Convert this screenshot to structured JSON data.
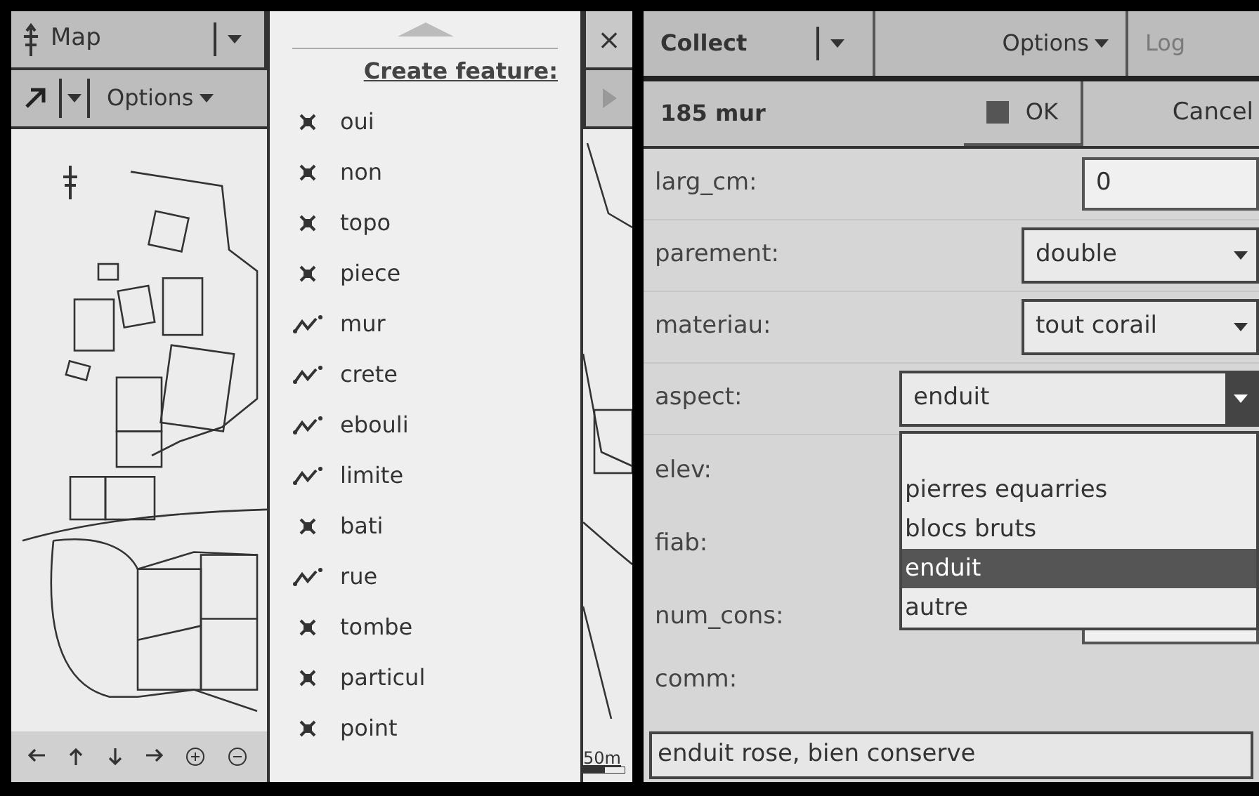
{
  "left_screen": {
    "toolbar": {
      "map_menu": "Map",
      "options_menu": "Options",
      "close_button": "×"
    },
    "create_menu": {
      "title": "Create feature:",
      "items": [
        {
          "label": "oui",
          "kind": "point"
        },
        {
          "label": "non",
          "kind": "point"
        },
        {
          "label": "topo",
          "kind": "point"
        },
        {
          "label": "piece",
          "kind": "point"
        },
        {
          "label": "mur",
          "kind": "line"
        },
        {
          "label": "crete",
          "kind": "line"
        },
        {
          "label": "ebouli",
          "kind": "line"
        },
        {
          "label": "limite",
          "kind": "line"
        },
        {
          "label": "bati",
          "kind": "point"
        },
        {
          "label": "rue",
          "kind": "line"
        },
        {
          "label": "tombe",
          "kind": "point"
        },
        {
          "label": "particul",
          "kind": "point"
        },
        {
          "label": "point",
          "kind": "point"
        }
      ]
    },
    "scale_label": "50m"
  },
  "right_screen": {
    "toolbar": {
      "collect_menu": "Collect",
      "options_menu": "Options",
      "log_tab": {
        "label": "Log",
        "disabled": true
      }
    },
    "feature": {
      "title": "185 mur",
      "ok": "OK",
      "cancel": "Cancel"
    },
    "fields": [
      {
        "label": "larg_cm:",
        "kind": "text",
        "value": "0"
      },
      {
        "label": "parement:",
        "kind": "select",
        "value": "double",
        "expanded": false
      },
      {
        "label": "materiau:",
        "kind": "select",
        "value": "tout corail",
        "expanded": false
      },
      {
        "label": "aspect:",
        "kind": "select",
        "value": "enduit",
        "expanded": true
      },
      {
        "label": "elev:",
        "kind": "none"
      },
      {
        "label": "fiab:",
        "kind": "none"
      },
      {
        "label": "num_cons:",
        "kind": "text"
      }
    ],
    "dropdown": {
      "options": [
        {
          "label": "pierres equarries",
          "selected": false
        },
        {
          "label": "blocs bruts",
          "selected": false
        },
        {
          "label": "enduit",
          "selected": true
        },
        {
          "label": "autre",
          "selected": false
        }
      ]
    },
    "comment": {
      "label": "comm:",
      "value": "enduit rose, bien conserve"
    }
  }
}
